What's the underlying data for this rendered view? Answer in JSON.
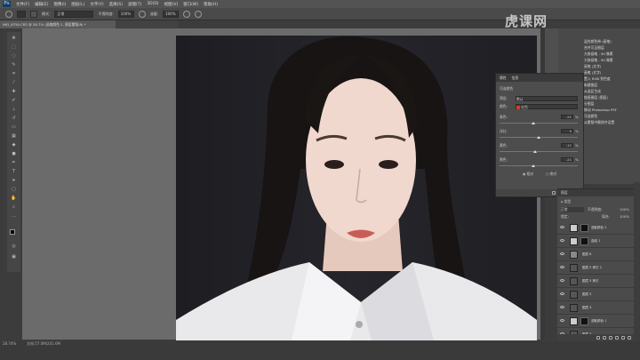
{
  "app_logo": "Ps",
  "menus": [
    "文件(F)",
    "编辑(E)",
    "图像(I)",
    "图层(L)",
    "文字(Y)",
    "选择(S)",
    "滤镜(T)",
    "3D(D)",
    "视图(V)",
    "窗口(W)",
    "帮助(H)"
  ],
  "options": {
    "mode_label": "模式:",
    "mode_value": "正常",
    "opacity_label": "不透明度:",
    "opacity_value": "100%",
    "flow_label": "流量:",
    "flow_value": "100%"
  },
  "doc_tab": "IMG_6750.CR2 @ 28.7% (选取颜色 2, 图层蒙版/8) *",
  "status": {
    "zoom": "28.74%",
    "doc": "文档:57.0M/201.6M"
  },
  "properties": {
    "tabs": [
      "属性",
      "信息"
    ],
    "title": "可选颜色",
    "preset_label": "预设:",
    "preset_value": "默认",
    "colors_label": "颜色:",
    "colors_value": "红色",
    "sliders": [
      {
        "label": "青色:",
        "value": "-21",
        "knob": 0.43
      },
      {
        "label": "洋红:",
        "value": "0",
        "knob": 0.5
      },
      {
        "label": "黄色:",
        "value": "-11",
        "knob": 0.45
      },
      {
        "label": "黑色:",
        "value": "-21",
        "knob": 0.43
      }
    ],
    "pct": "%",
    "radio1": "相对",
    "radio2": "绝对"
  },
  "history": {
    "items": [
      "混合颜色带 (画笔)",
      "合并可见图层",
      "大修画笔 - 90 像素",
      "大修画笔 - 90 像素",
      "画笔 (文字)",
      "画笔 (文字)",
      "置入 RGB 到色度",
      "新建图层",
      "从选区生成",
      "链接图层 (图层)",
      "分图层",
      "移动 Photoshop PSF",
      "可选颜色",
      "从蒙版中删除并设置"
    ]
  },
  "watermark": "虎课网",
  "layers": {
    "header": "图层",
    "kind_label": "ρ 类型",
    "blend": "正常",
    "opacity_label": "不透明度:",
    "opacity_value": "100%",
    "fill_label": "填充:",
    "fill_value": "100%",
    "lock_label": "锁定:",
    "rows": [
      {
        "name": "选取颜色 2",
        "selected": false
      },
      {
        "name": "曲线 1",
        "selected": false
      },
      {
        "name": "图层 6",
        "selected": false
      },
      {
        "name": "图层 5 拷贝 2",
        "selected": false
      },
      {
        "name": "图层 5 拷贝",
        "selected": false
      },
      {
        "name": "图层 5",
        "selected": false
      },
      {
        "name": "图层 4",
        "selected": false
      },
      {
        "name": "选取颜色 1",
        "selected": false
      },
      {
        "name": "图层 3",
        "selected": false
      },
      {
        "name": "背景",
        "selected": false
      }
    ]
  },
  "colors": {
    "accent_red": "#d43b2a",
    "selected_layer": "#5c6677"
  }
}
